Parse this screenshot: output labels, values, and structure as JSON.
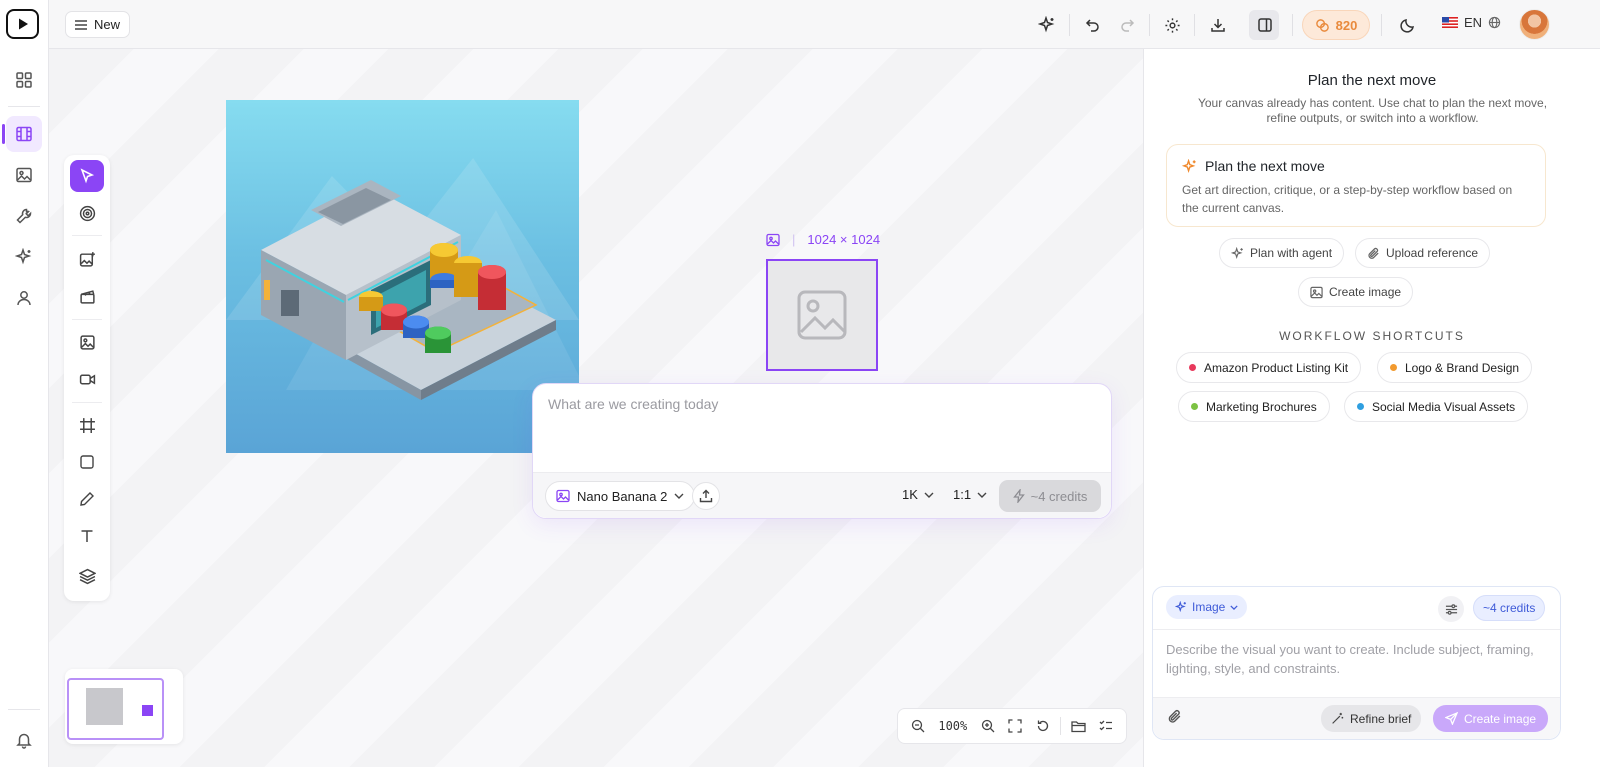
{
  "topbar": {
    "new_label": "New",
    "credits": "820",
    "language": "EN"
  },
  "canvas": {
    "placeholder_size": "1024 × 1024",
    "prompt": {
      "placeholder": "What are we creating today",
      "model": "Nano Banana 2",
      "resolution": "1K",
      "aspect": "1:1",
      "cost": "~4 credits"
    },
    "zoom": "100%"
  },
  "panel": {
    "title": "Plan the next move",
    "description": "Your canvas already has content. Use chat to plan the next move, refine outputs, or switch into a workflow.",
    "card": {
      "title": "Plan the next move",
      "description": "Get art direction, critique, or a step-by-step workflow based on the current canvas."
    },
    "chips": [
      {
        "label": "Plan with agent"
      },
      {
        "label": "Upload reference"
      },
      {
        "label": "Create image"
      }
    ],
    "workflow_heading": "WORKFLOW SHORTCUTS",
    "workflows": [
      {
        "label": "Amazon Product Listing Kit",
        "color": "#e8395c"
      },
      {
        "label": "Logo & Brand Design",
        "color": "#f29a2e"
      },
      {
        "label": "Marketing Brochures",
        "color": "#7cc243"
      },
      {
        "label": "Social Media Visual Assets",
        "color": "#2f9fe0"
      }
    ],
    "composer": {
      "mode": "Image",
      "cost": "~4 credits",
      "placeholder": "Describe the visual you want to create. Include subject, framing, lighting, style, and constraints.",
      "refine_label": "Refine brief",
      "create_label": "Create image"
    }
  },
  "colors": {
    "accent": "#8b45f5",
    "credits": "#e98a3c"
  }
}
